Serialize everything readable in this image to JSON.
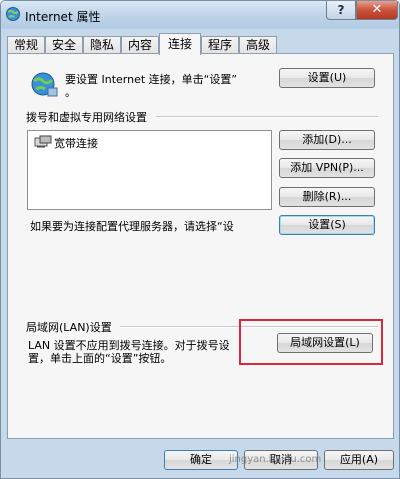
{
  "window": {
    "title": "Internet 属性",
    "help_label": "?",
    "close_label": "✕"
  },
  "tabs": [
    {
      "label": "常规"
    },
    {
      "label": "安全"
    },
    {
      "label": "隐私"
    },
    {
      "label": "内容"
    },
    {
      "label": "连接",
      "active": true
    },
    {
      "label": "程序"
    },
    {
      "label": "高级"
    }
  ],
  "setup": {
    "text_line1": "要设置 Internet 连接，单击“设置”",
    "text_line2": "。",
    "button": "设置(U)"
  },
  "dialup": {
    "group_label": "拨号和虚拟专用网络设置",
    "connections": [
      {
        "name": "宽带连接"
      }
    ],
    "add_button": "添加(D)...",
    "add_vpn_button": "添加 VPN(P)...",
    "remove_button": "删除(R)...",
    "proxy_text": "如果要为连接配置代理服务器，请选择“设",
    "settings_button": "设置(S)"
  },
  "lan": {
    "group_label": "局域网(LAN)设置",
    "text_line1": "LAN 设置不应用到拨号连接。对于拨号设",
    "text_line2": "置，单击上面的“设置”按钮。",
    "button": "局域网设置(L)"
  },
  "footer": {
    "ok_button": "确定",
    "cancel_button": "取消",
    "apply_button": "应用(A)"
  },
  "watermark": "jingyan.baidu.com",
  "colors": {
    "highlight_box": "#d8283b",
    "focus_border": "#3c7fb1"
  }
}
